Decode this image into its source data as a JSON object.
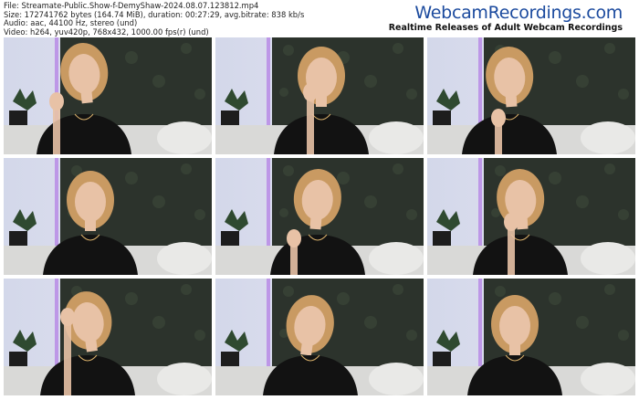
{
  "meta": {
    "file": "File: Streamate-Public.Show-f-DemyShaw-2024.08.07.123812.mp4",
    "size": "Size: 172741762 bytes (164.74 MiB), duration: 00:27:29, avg.bitrate: 838 kb/s",
    "audio": "Audio: aac, 44100 Hz, stereo (und)",
    "video": "Video: h264, yuv420p, 768x432, 1000.00 fps(r) (und)"
  },
  "brand": {
    "name": "WebcamRecordings.com",
    "tagline": "Realtime Releases of Adult Webcam Recordings"
  },
  "colors": {
    "brand_blue": "#1b4a9e",
    "wall_left": "#d3d8ea",
    "hedge": "#2c332c",
    "sofa": "#d9d9d7",
    "shirt": "#121212",
    "hair": "#c99a62",
    "skin": "#e8c2a6",
    "purple_glow": "#b27ae6"
  },
  "thumbnails": [
    {
      "pose": "hand-raised-left"
    },
    {
      "pose": "hand-to-mouth"
    },
    {
      "pose": "hands-clasped"
    },
    {
      "pose": "neutral"
    },
    {
      "pose": "hand-out-front"
    },
    {
      "pose": "hand-to-chin"
    },
    {
      "pose": "hand-on-forehead"
    },
    {
      "pose": "looking-down"
    },
    {
      "pose": "smiling"
    }
  ]
}
